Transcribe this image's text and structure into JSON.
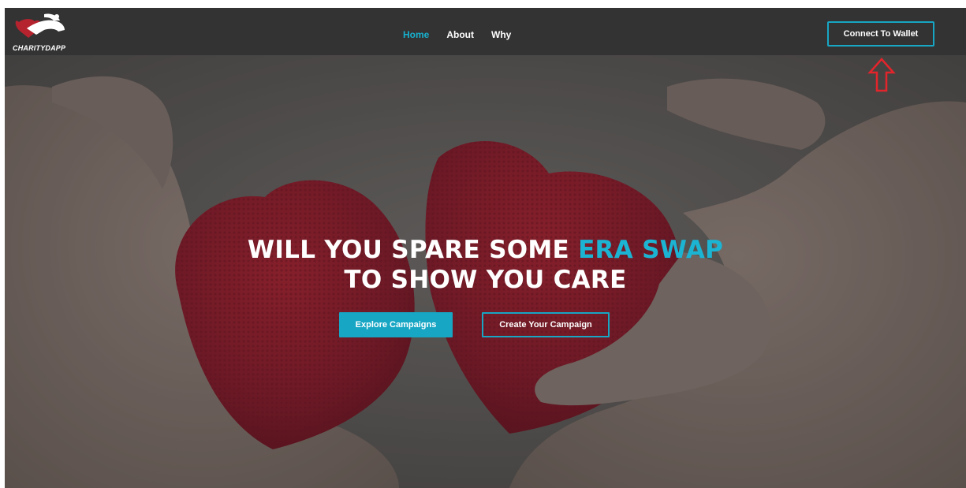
{
  "brand": {
    "name": "CHARITYDAPP"
  },
  "nav": {
    "links": [
      {
        "label": "Home",
        "active": true
      },
      {
        "label": "About",
        "active": false
      },
      {
        "label": "Why",
        "active": false
      }
    ],
    "connect_label": "Connect To Wallet"
  },
  "hero": {
    "headline_part1": "WILL YOU SPARE SOME ",
    "headline_accent": "ERA SWAP",
    "headline_line2": "TO SHOW YOU CARE",
    "explore_label": "Explore Campaigns",
    "create_label": "Create Your Campaign"
  },
  "annotation": {
    "icon": "up-arrow-icon",
    "color": "#e3242b"
  },
  "colors": {
    "accent": "#17a6c4",
    "navbar": "#333333",
    "heart": "#8f1a2c"
  }
}
